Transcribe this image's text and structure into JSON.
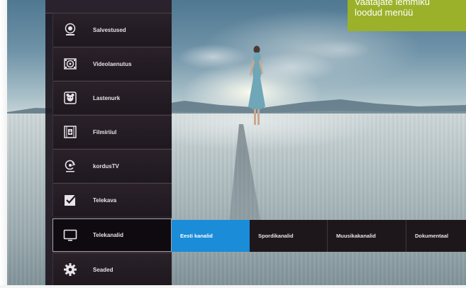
{
  "callout": {
    "line1": "Vaatajate lemmiku",
    "line2": "loodud menüü",
    "color": "#9bb12a"
  },
  "menu": {
    "items": [
      {
        "label": "Salvestused",
        "icon": "record-icon"
      },
      {
        "label": "Videolaenutus",
        "icon": "film-reel-icon"
      },
      {
        "label": "Lastenurk",
        "icon": "bear-icon"
      },
      {
        "label": "Filmiriiul",
        "icon": "film-strip-icon"
      },
      {
        "label": "kordusTV",
        "icon": "replay-icon"
      },
      {
        "label": "Telekava",
        "icon": "checkbox-icon"
      },
      {
        "label": "Telekanalid",
        "icon": "tv-icon",
        "active": true
      },
      {
        "label": "Seaded",
        "icon": "gear-icon"
      }
    ]
  },
  "submenu": {
    "items": [
      {
        "label": "Eesti kanalid",
        "active": true
      },
      {
        "label": "Spordikanalid"
      },
      {
        "label": "Muusikakanalid"
      },
      {
        "label": "Dokumentaal"
      }
    ],
    "active_color": "#1a8cd8"
  }
}
